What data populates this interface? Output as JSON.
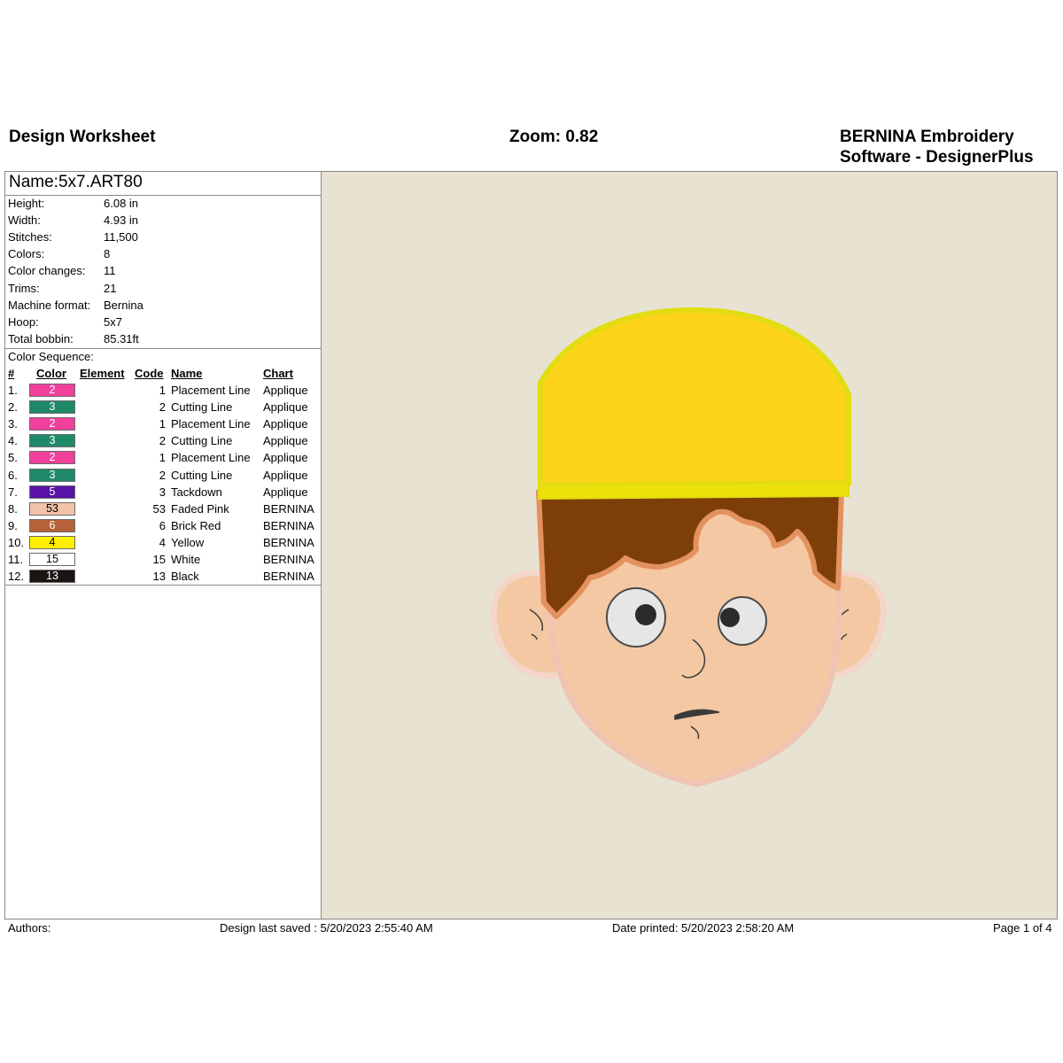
{
  "header": {
    "title": "Design Worksheet",
    "zoom": "Zoom:  0.82",
    "brand_line1": "BERNINA Embroidery",
    "brand_line2": "Software - DesignerPlus"
  },
  "design": {
    "name": "Name:5x7.ART80",
    "properties": [
      {
        "key": "Height:",
        "value": "6.08 in"
      },
      {
        "key": "Width:",
        "value": "4.93 in"
      },
      {
        "key": "Stitches:",
        "value": "11,500"
      },
      {
        "key": "Colors:",
        "value": "8"
      },
      {
        "key": "Color changes:",
        "value": "11"
      },
      {
        "key": "Trims:",
        "value": "21"
      },
      {
        "key": "Machine format:",
        "value": "Bernina"
      },
      {
        "key": "Hoop:",
        "value": "5x7"
      },
      {
        "key": "Total bobbin:",
        "value": "85.31ft"
      }
    ]
  },
  "sequence": {
    "title": "Color Sequence:",
    "headers": {
      "num": "#",
      "color": "Color",
      "element": "Element",
      "code": "Code",
      "name": "Name",
      "chart": "Chart"
    },
    "rows": [
      {
        "num": "1.",
        "swatch": "2",
        "bg": "#f0409c",
        "fg": "#ffffff",
        "code": "1",
        "name": "Placement Line",
        "chart": "Applique"
      },
      {
        "num": "2.",
        "swatch": "3",
        "bg": "#1f8a6a",
        "fg": "#ffffff",
        "code": "2",
        "name": "Cutting Line",
        "chart": "Applique"
      },
      {
        "num": "3.",
        "swatch": "2",
        "bg": "#f0409c",
        "fg": "#ffffff",
        "code": "1",
        "name": "Placement Line",
        "chart": "Applique"
      },
      {
        "num": "4.",
        "swatch": "3",
        "bg": "#1f8a6a",
        "fg": "#ffffff",
        "code": "2",
        "name": "Cutting Line",
        "chart": "Applique"
      },
      {
        "num": "5.",
        "swatch": "2",
        "bg": "#f0409c",
        "fg": "#ffffff",
        "code": "1",
        "name": "Placement Line",
        "chart": "Applique"
      },
      {
        "num": "6.",
        "swatch": "3",
        "bg": "#1f8a6a",
        "fg": "#ffffff",
        "code": "2",
        "name": "Cutting Line",
        "chart": "Applique"
      },
      {
        "num": "7.",
        "swatch": "5",
        "bg": "#5a12a6",
        "fg": "#ffffff",
        "code": "3",
        "name": "Tackdown",
        "chart": "Applique"
      },
      {
        "num": "8.",
        "swatch": "53",
        "bg": "#f2c2a8",
        "fg": "#000000",
        "code": "53",
        "name": "Faded Pink",
        "chart": "BERNINA"
      },
      {
        "num": "9.",
        "swatch": "6",
        "bg": "#b5613a",
        "fg": "#ffffff",
        "code": "6",
        "name": "Brick Red",
        "chart": "BERNINA"
      },
      {
        "num": "10.",
        "swatch": "4",
        "bg": "#ffef00",
        "fg": "#000000",
        "code": "4",
        "name": "Yellow",
        "chart": "BERNINA"
      },
      {
        "num": "11.",
        "swatch": "15",
        "bg": "#ffffff",
        "fg": "#000000",
        "code": "15",
        "name": "White",
        "chart": "BERNINA"
      },
      {
        "num": "12.",
        "swatch": "13",
        "bg": "#1a1412",
        "fg": "#ffffff",
        "code": "13",
        "name": "Black",
        "chart": "BERNINA"
      }
    ]
  },
  "footer": {
    "authors": "Authors:",
    "saved": "Design last saved : 5/20/2023 2:55:40 AM",
    "printed": "Date printed: 5/20/2023 2:58:20 AM",
    "page": "Page 1 of 4"
  },
  "colors": {
    "canvas_bg": "#e8e2d2",
    "hat_fill": "#fdd31a",
    "hat_outline": "#e2dc10",
    "skin": "#f3c8a2",
    "skin_outline": "#f0c4b2",
    "hair": "#7e3e08",
    "hair_outline": "#e3915e",
    "ear_outline": "#f3d6c8"
  }
}
